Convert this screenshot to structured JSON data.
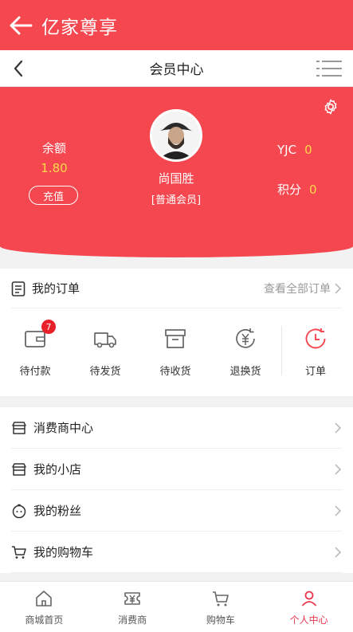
{
  "appbar": {
    "title": "亿家尊享"
  },
  "navbar": {
    "title": "会员中心"
  },
  "profile": {
    "name": "尚国胜",
    "level": "[普通会员]",
    "balance_label": "余额",
    "balance_value": "1.80",
    "recharge_label": "充值",
    "yjc_label": "YJC",
    "yjc_value": "0",
    "points_label": "积分",
    "points_value": "0"
  },
  "orders": {
    "title": "我的订单",
    "view_all": "查看全部订单",
    "items": [
      {
        "label": "待付款",
        "icon": "wallet-icon",
        "badge": "7"
      },
      {
        "label": "待发货",
        "icon": "truck-icon"
      },
      {
        "label": "待收货",
        "icon": "box-icon"
      },
      {
        "label": "退换货",
        "icon": "refund-icon"
      },
      {
        "label": "订单",
        "icon": "clock-icon"
      }
    ]
  },
  "menu": [
    {
      "label": "消费商中心",
      "icon": "store-icon"
    },
    {
      "label": "我的小店",
      "icon": "shop-icon"
    },
    {
      "label": "我的粉丝",
      "icon": "fans-icon"
    },
    {
      "label": "我的购物车",
      "icon": "cart-icon"
    }
  ],
  "tabs": [
    {
      "label": "商城首页",
      "icon": "home-icon"
    },
    {
      "label": "消费商",
      "icon": "yen-ticket-icon"
    },
    {
      "label": "购物车",
      "icon": "cart-icon"
    },
    {
      "label": "个人中心",
      "icon": "person-icon",
      "active": true
    }
  ],
  "colors": {
    "brand_red": "#f5474f",
    "highlight_yellow": "#ffd84a",
    "active_tab": "#e8384f",
    "badge_red": "#e8202a"
  }
}
